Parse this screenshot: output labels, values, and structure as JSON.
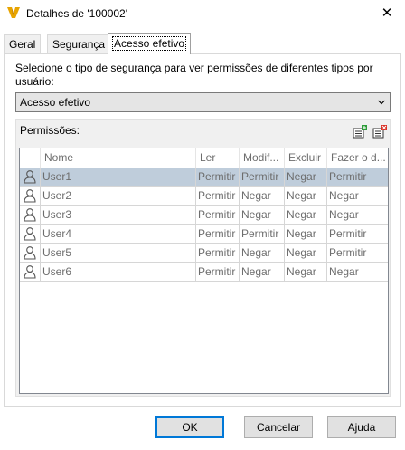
{
  "window": {
    "title": "Detalhes de '100002'",
    "close_glyph": "✕",
    "app_icon": "vault-logo-icon",
    "accent": "#e8a400"
  },
  "tabs": [
    {
      "label": "Geral",
      "active": false
    },
    {
      "label": "Segurança",
      "active": false
    },
    {
      "label": "Acesso efetivo",
      "active": true
    }
  ],
  "description": "Selecione o tipo de segurança para ver permissões de diferentes tipos por usuário:",
  "combo": {
    "value": "Acesso efetivo"
  },
  "permissions": {
    "label": "Permissões:",
    "toolbar_icons": [
      "add-user-icon",
      "remove-user-icon"
    ],
    "columns": [
      "Nome",
      "Ler",
      "Modif...",
      "Excluir",
      "Fazer o d..."
    ],
    "rows": [
      {
        "name": "User1",
        "values": [
          "Permitir",
          "Permitir",
          "Negar",
          "Permitir"
        ],
        "selected": true
      },
      {
        "name": "User2",
        "values": [
          "Permitir",
          "Negar",
          "Negar",
          "Negar"
        ],
        "selected": false
      },
      {
        "name": "User3",
        "values": [
          "Permitir",
          "Negar",
          "Negar",
          "Negar"
        ],
        "selected": false
      },
      {
        "name": "User4",
        "values": [
          "Permitir",
          "Permitir",
          "Negar",
          "Permitir"
        ],
        "selected": false
      },
      {
        "name": "User5",
        "values": [
          "Permitir",
          "Negar",
          "Negar",
          "Permitir"
        ],
        "selected": false
      },
      {
        "name": "User6",
        "values": [
          "Permitir",
          "Negar",
          "Negar",
          "Negar"
        ],
        "selected": false
      }
    ]
  },
  "buttons": {
    "ok": "OK",
    "cancel": "Cancelar",
    "help": "Ajuda"
  },
  "colors": {
    "selected_row": "#bfcddb",
    "default_button_border": "#0078d7"
  }
}
